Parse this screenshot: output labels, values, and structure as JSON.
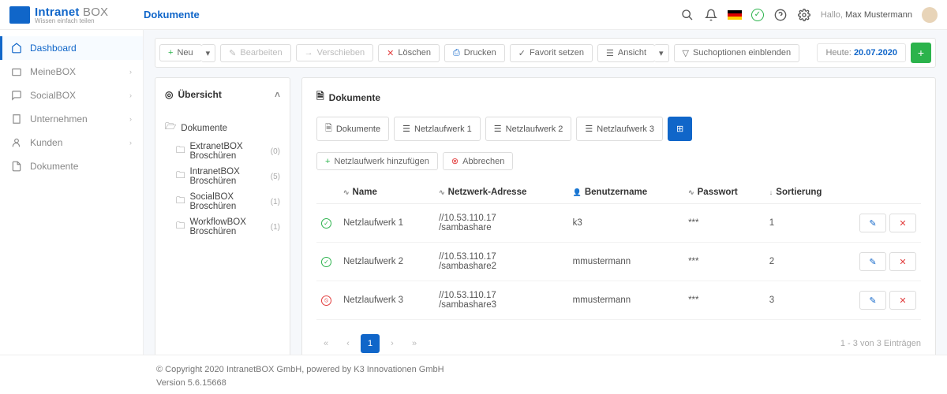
{
  "header": {
    "logo_main": "Intranet",
    "logo_accent": "BOX",
    "logo_tagline": "Wissen einfach teilen",
    "page_title": "Dokumente",
    "greeting_prefix": "Hallo,",
    "greeting_name": "Max Mustermann"
  },
  "sidebar": {
    "items": [
      {
        "label": "Dashboard",
        "icon": "home",
        "active": true,
        "expandable": false
      },
      {
        "label": "MeineBOX",
        "icon": "box",
        "active": false,
        "expandable": true
      },
      {
        "label": "SocialBOX",
        "icon": "chat",
        "active": false,
        "expandable": true
      },
      {
        "label": "Unternehmen",
        "icon": "building",
        "active": false,
        "expandable": true
      },
      {
        "label": "Kunden",
        "icon": "user",
        "active": false,
        "expandable": true
      },
      {
        "label": "Dokumente",
        "icon": "doc",
        "active": false,
        "expandable": false
      }
    ]
  },
  "toolbar": {
    "new_label": "Neu",
    "edit_label": "Bearbeiten",
    "move_label": "Verschieben",
    "delete_label": "Löschen",
    "print_label": "Drucken",
    "favorite_label": "Favorit setzen",
    "view_label": "Ansicht",
    "search_opts_label": "Suchoptionen einblenden",
    "date_prefix": "Heute:",
    "date_value": "20.07.2020"
  },
  "tree": {
    "header": "Übersicht",
    "root": "Dokumente",
    "folders": [
      {
        "label": "ExtranetBOX Broschüren",
        "count": "(0)"
      },
      {
        "label": "IntranetBOX Broschüren",
        "count": "(5)"
      },
      {
        "label": "SocialBOX Broschüren",
        "count": "(1)"
      },
      {
        "label": "WorkflowBOX Broschüren",
        "count": "(1)"
      }
    ]
  },
  "doc": {
    "header": "Dokumente",
    "tabs": [
      {
        "label": "Dokumente",
        "icon": "doc"
      },
      {
        "label": "Netzlaufwerk 1",
        "icon": "list"
      },
      {
        "label": "Netzlaufwerk 2",
        "icon": "list"
      },
      {
        "label": "Netzlaufwerk 3",
        "icon": "list"
      }
    ],
    "add_drive_label": "Netzlaufwerk hinzufügen",
    "cancel_label": "Abbrechen",
    "columns": {
      "name": "Name",
      "addr": "Netzwerk-Adresse",
      "user": "Benutzername",
      "pwd": "Passwort",
      "sort": "Sortierung"
    },
    "rows": [
      {
        "status": "ok",
        "name": "Netzlaufwerk 1",
        "addr": "//10.53.110.17\n/sambashare",
        "user": "k3",
        "pwd": "***",
        "sort": "1"
      },
      {
        "status": "ok",
        "name": "Netzlaufwerk 2",
        "addr": "//10.53.110.17\n/sambashare2",
        "user": "mmustermann",
        "pwd": "***",
        "sort": "2"
      },
      {
        "status": "err",
        "name": "Netzlaufwerk 3",
        "addr": "//10.53.110.17\n/sambashare3",
        "user": "mmustermann",
        "pwd": "***",
        "sort": "3"
      }
    ],
    "pager_info": "1 - 3 von 3 Einträgen",
    "current_page": "1"
  },
  "footer": {
    "copyright": "© Copyright 2020 IntranetBOX GmbH, powered by K3 Innovationen GmbH",
    "version": "Version 5.6.15668"
  }
}
